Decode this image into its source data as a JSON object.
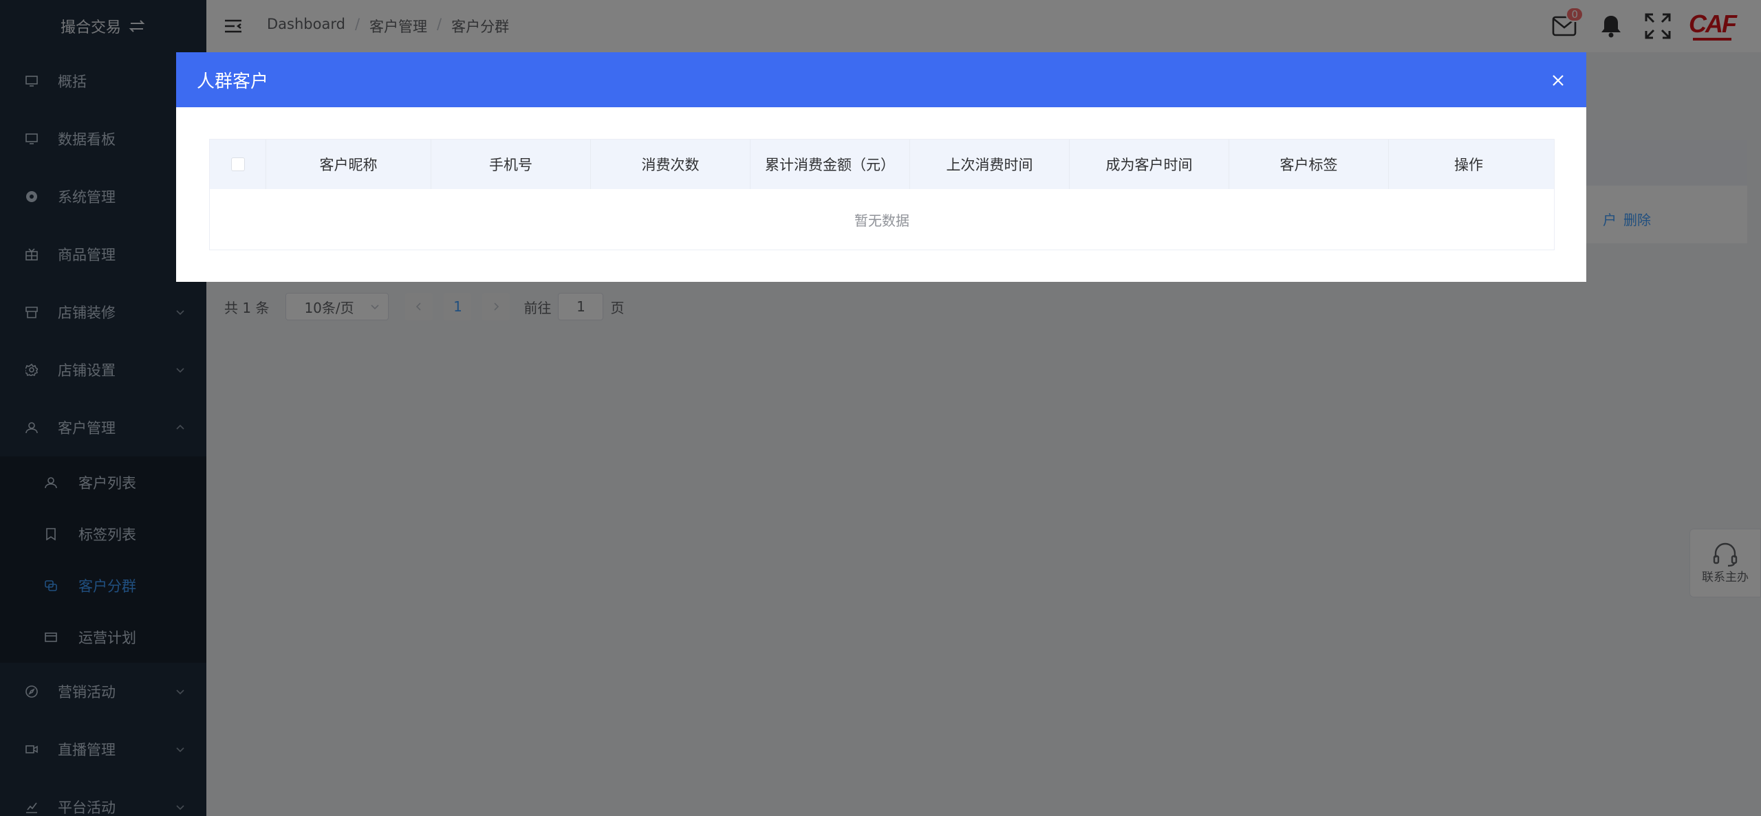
{
  "sidebar": {
    "brand": "撮合交易",
    "items": [
      {
        "label": "概括",
        "icon": "monitor-icon"
      },
      {
        "label": "数据看板",
        "icon": "monitor-icon"
      },
      {
        "label": "系统管理",
        "icon": "settings-circle-icon"
      },
      {
        "label": "商品管理",
        "icon": "grid-icon"
      },
      {
        "label": "店铺装修",
        "icon": "shop-icon"
      },
      {
        "label": "店铺设置",
        "icon": "gear-icon"
      },
      {
        "label": "客户管理",
        "icon": "user-icon"
      }
    ],
    "sub_items": [
      {
        "label": "客户列表",
        "icon": "user-icon"
      },
      {
        "label": "标签列表",
        "icon": "bookmark-icon"
      },
      {
        "label": "客户分群",
        "icon": "group-icon",
        "active": true
      },
      {
        "label": "运营计划",
        "icon": "card-icon"
      }
    ],
    "bottom_items": [
      {
        "label": "营销活动",
        "icon": "compass-icon"
      },
      {
        "label": "直播管理",
        "icon": "video-icon"
      },
      {
        "label": "平台活动",
        "icon": "chart-icon"
      }
    ]
  },
  "header": {
    "breadcrumb": [
      "Dashboard",
      "客户管理",
      "客户分群"
    ],
    "separator": "/",
    "mail_badge": "0",
    "logo_text": "CAF"
  },
  "background": {
    "row_action_partial": "户",
    "row_action_delete": "删除",
    "pagination": {
      "total": "共 1 条",
      "page_size": "10条/页",
      "current_page": "1",
      "goto_label": "前往",
      "goto_value": "1",
      "page_suffix": "页"
    },
    "float_contact": "联系主办"
  },
  "modal": {
    "title": "人群客户",
    "columns": [
      "客户昵称",
      "手机号",
      "消费次数",
      "累计消费金额（元）",
      "上次消费时间",
      "成为客户时间",
      "客户标签",
      "操作"
    ],
    "empty_text": "暂无数据"
  },
  "colors": {
    "sidebar_bg": "#1f2d3d",
    "modal_header": "#3d6bf1",
    "accent": "#409eff",
    "logo_red": "#d8141b"
  }
}
